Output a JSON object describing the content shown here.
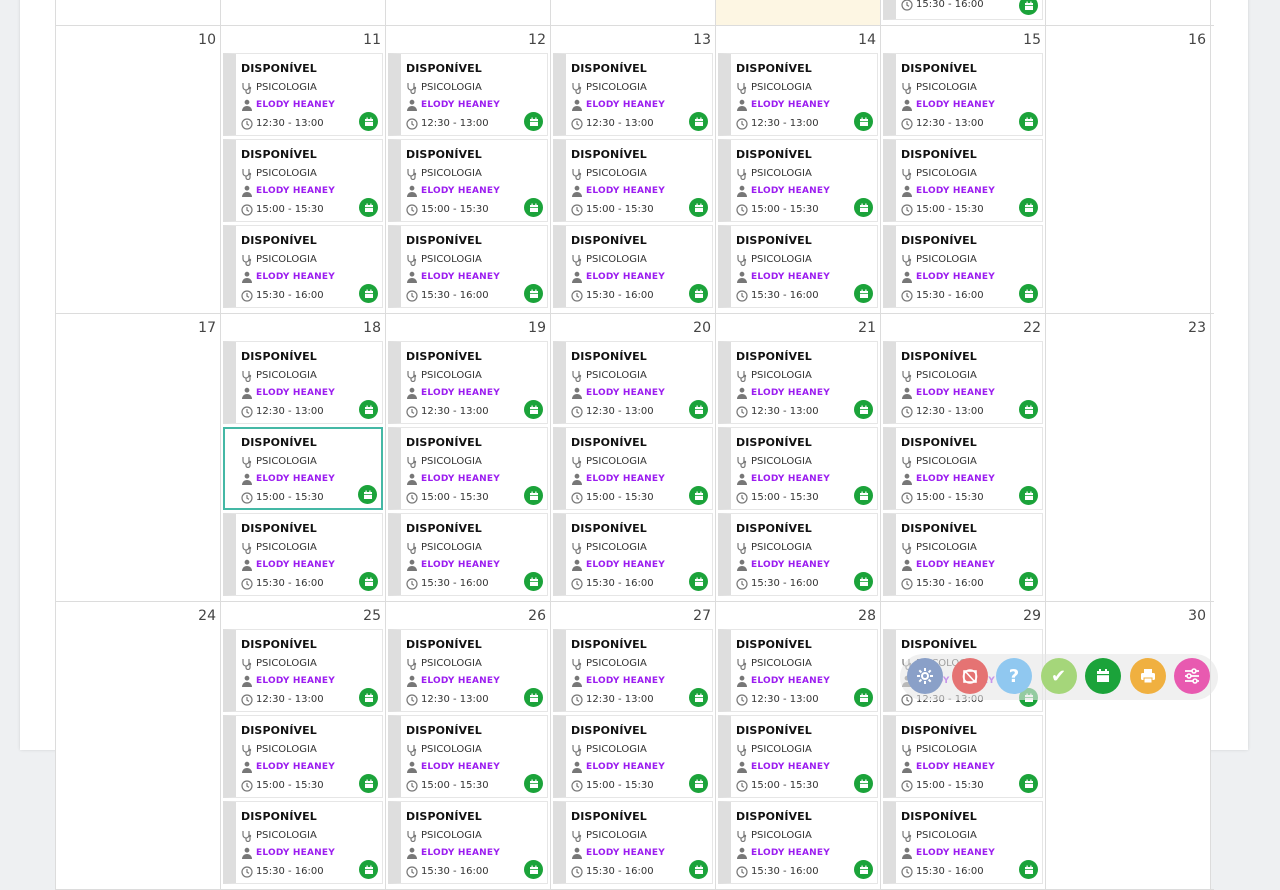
{
  "slot_status": "DISPONÍVEL",
  "slot_specialty": "PSICOLOGIA",
  "slot_provider": "ELODY HEANEY",
  "times": [
    "12:30 - 13:00",
    "15:00 - 15:30",
    "15:30 - 16:00"
  ],
  "weeks": [
    {
      "days": [
        "",
        "",
        "",
        "",
        "",
        "",
        ""
      ],
      "partial_time": "15:30 - 16:00"
    },
    {
      "days": [
        "10",
        "11",
        "12",
        "13",
        "14",
        "15",
        "16"
      ]
    },
    {
      "days": [
        "17",
        "18",
        "19",
        "20",
        "21",
        "22",
        "23"
      ]
    },
    {
      "days": [
        "24",
        "25",
        "26",
        "27",
        "28",
        "29",
        "30"
      ]
    }
  ],
  "toolbar": {
    "buttons": [
      {
        "name": "settings-button",
        "color": "#8aa0c8",
        "icon": "gear-icon"
      },
      {
        "name": "cancel-schedule-button",
        "color": "#e57373",
        "icon": "calendar-cancel-icon"
      },
      {
        "name": "help-button",
        "color": "#90c8f0",
        "icon": "question-icon",
        "label": "?"
      },
      {
        "name": "confirm-button",
        "color": "#a5d67a",
        "icon": "check-icon",
        "label": "✔"
      },
      {
        "name": "calendar-button",
        "color": "#1ba33a",
        "icon": "calendar-icon"
      },
      {
        "name": "print-button",
        "color": "#f0b040",
        "icon": "printer-icon"
      },
      {
        "name": "filter-button",
        "color": "#e85ab0",
        "icon": "sliders-icon"
      }
    ]
  }
}
